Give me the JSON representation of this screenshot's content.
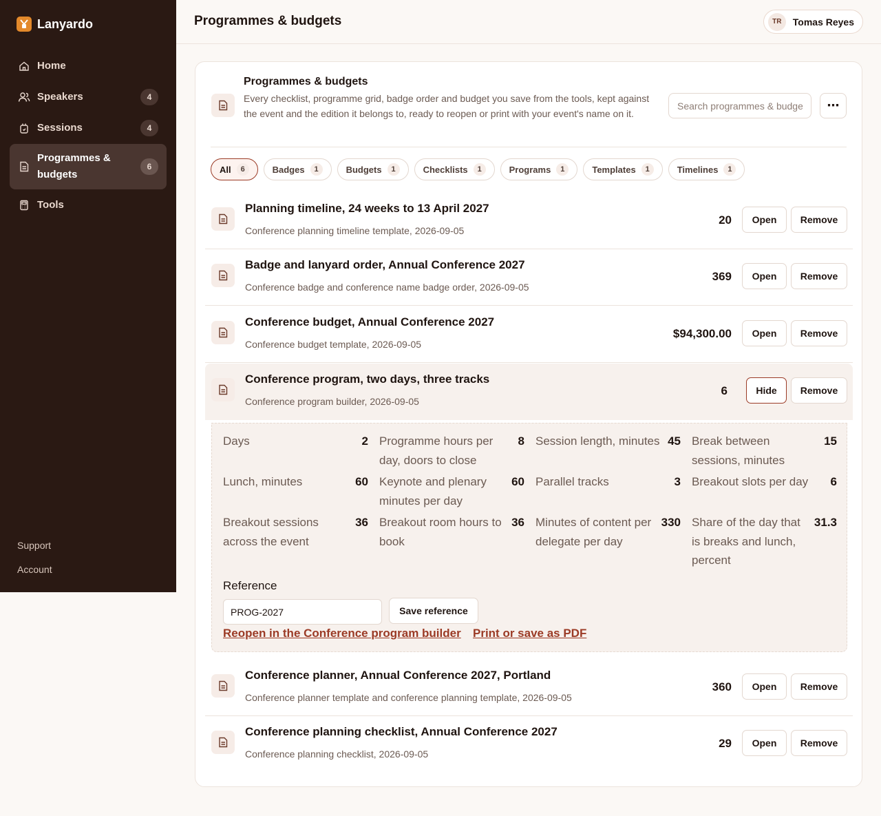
{
  "app": {
    "name": "Lanyardo"
  },
  "sidebar": {
    "items": [
      {
        "label": "Home",
        "icon": "home-icon",
        "badge": ""
      },
      {
        "label": "Speakers",
        "icon": "users-icon",
        "badge": "4"
      },
      {
        "label": "Sessions",
        "icon": "badge-icon",
        "badge": "4"
      },
      {
        "label": "Programmes & budgets",
        "icon": "document-icon",
        "badge": "6"
      },
      {
        "label": "Tools",
        "icon": "calculator-icon",
        "badge": ""
      }
    ],
    "footer": {
      "support": "Support",
      "account": "Account"
    }
  },
  "header": {
    "title": "Programmes & budgets",
    "user": {
      "initials": "TR",
      "name": "Tomas Reyes"
    }
  },
  "card": {
    "title": "Programmes & budgets",
    "description": "Every checklist, programme grid, badge order and budget you save from the tools, kept against the event and the edition it belongs to, ready to reopen or print with your event's name on it.",
    "search_placeholder": "Search programmes & budgets",
    "more": "⋯"
  },
  "filters": [
    {
      "label": "All",
      "count": "6"
    },
    {
      "label": "Badges",
      "count": "1"
    },
    {
      "label": "Budgets",
      "count": "1"
    },
    {
      "label": "Checklists",
      "count": "1"
    },
    {
      "label": "Programs",
      "count": "1"
    },
    {
      "label": "Templates",
      "count": "1"
    },
    {
      "label": "Timelines",
      "count": "1"
    }
  ],
  "actions": {
    "open": "Open",
    "remove": "Remove",
    "hide": "Hide"
  },
  "rows": [
    {
      "title": "Planning timeline, 24 weeks to 13 April 2027",
      "subtitle": "Conference planning timeline template, 2026-09-05",
      "value": "20"
    },
    {
      "title": "Badge and lanyard order, Annual Conference 2027",
      "subtitle": "Conference badge and conference name badge order, 2026-09-05",
      "value": "369"
    },
    {
      "title": "Conference budget, Annual Conference 2027",
      "subtitle": "Conference budget template, 2026-09-05",
      "value": "$94,300.00"
    },
    {
      "title": "Conference program, two days, three tracks",
      "subtitle": "Conference program builder, 2026-09-05",
      "value": "6"
    },
    {
      "title": "Conference planner, Annual Conference 2027, Portland",
      "subtitle": "Conference planner template and conference planning template, 2026-09-05",
      "value": "360"
    },
    {
      "title": "Conference planning checklist, Annual Conference 2027",
      "subtitle": "Conference planning checklist, 2026-09-05",
      "value": "29"
    }
  ],
  "detail": {
    "stats": [
      {
        "label": "Days",
        "value": "2"
      },
      {
        "label": "Programme hours per day, doors to close",
        "value": "8"
      },
      {
        "label": "Session length, minutes",
        "value": "45"
      },
      {
        "label": "Break between sessions, minutes",
        "value": "15"
      },
      {
        "label": "Lunch, minutes",
        "value": "60"
      },
      {
        "label": "Keynote and plenary minutes per day",
        "value": "60"
      },
      {
        "label": "Parallel tracks",
        "value": "3"
      },
      {
        "label": "Breakout slots per day",
        "value": "6"
      },
      {
        "label": "Breakout sessions across the event",
        "value": "36"
      },
      {
        "label": "Breakout room hours to book",
        "value": "36"
      },
      {
        "label": "Minutes of content per delegate per day",
        "value": "330"
      },
      {
        "label": "Share of the day that is breaks and lunch, percent",
        "value": "31.3"
      }
    ],
    "reference_label": "Reference",
    "reference_value": "PROG-2027",
    "save_reference": "Save reference",
    "reopen_link": "Reopen in the Conference program builder",
    "print_link": "Print or save as PDF"
  },
  "colors": {
    "sidebar": "#2a1913",
    "accent": "#9b3a25",
    "brand": "#e3892b"
  }
}
